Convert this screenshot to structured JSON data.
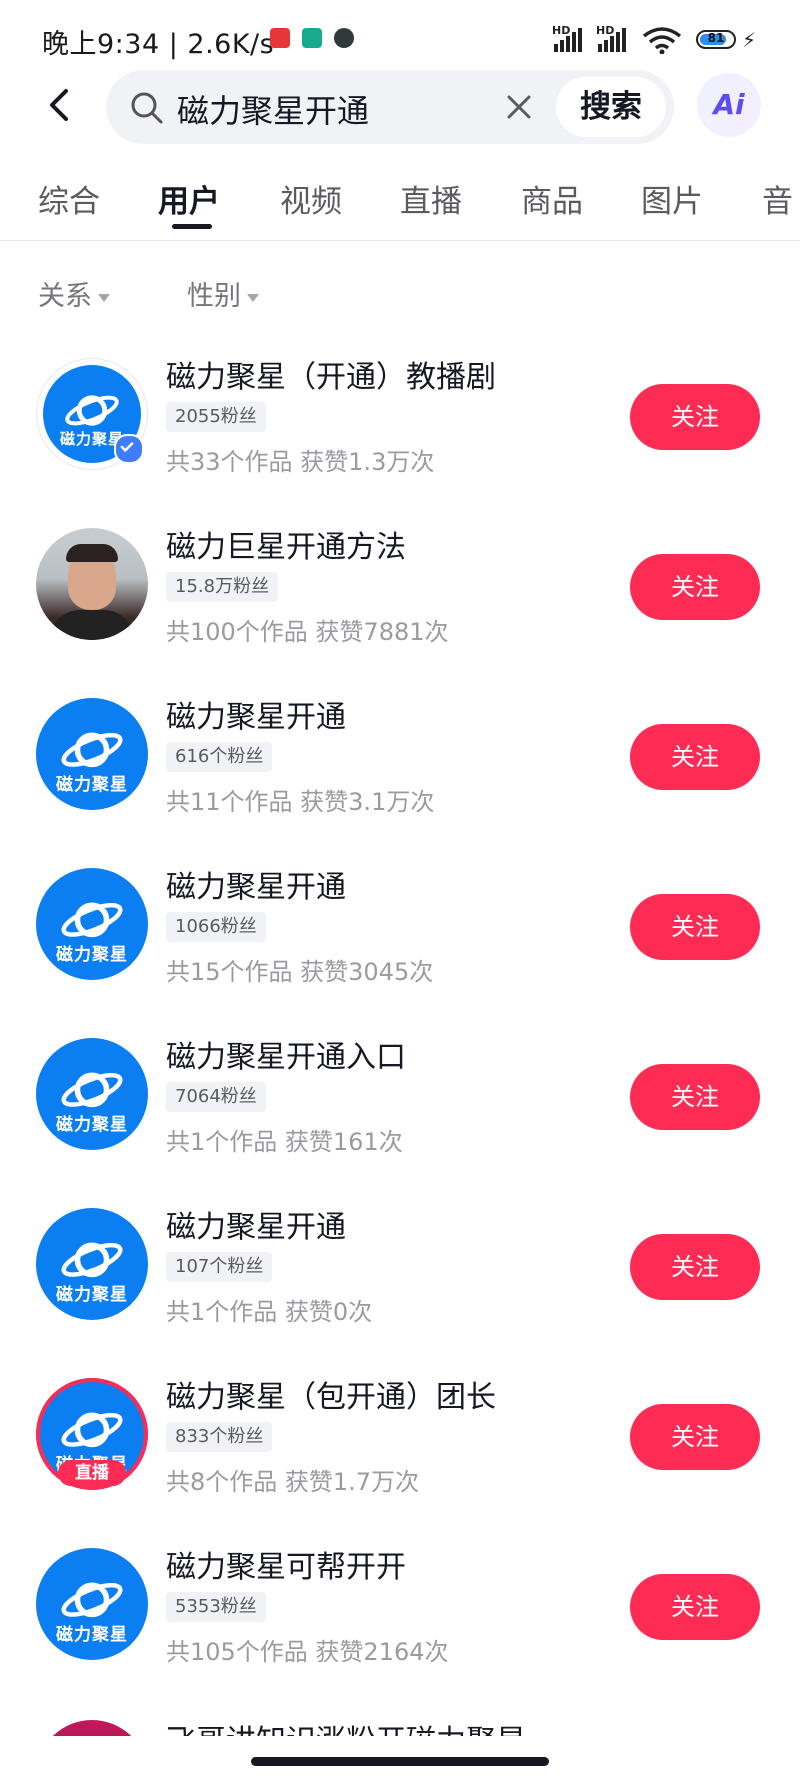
{
  "status_bar": {
    "time": "晚上9:34 | 2.6K/s",
    "signal1_label": "HD",
    "signal2_label": "HD",
    "battery": "81",
    "battery_level": 0.81
  },
  "search": {
    "query": "磁力聚星开通",
    "button_label": "搜索",
    "ai_label": "Ai"
  },
  "tabs": [
    {
      "label": "综合"
    },
    {
      "label": "用户"
    },
    {
      "label": "视频"
    },
    {
      "label": "直播"
    },
    {
      "label": "商品"
    },
    {
      "label": "图片"
    },
    {
      "label": "音"
    }
  ],
  "active_tab": "用户",
  "filters": [
    {
      "label": "关系"
    },
    {
      "label": "性别"
    }
  ],
  "results": [
    {
      "name": "磁力聚星（开通）教播剧",
      "fans": "2055粉丝",
      "meta": "共33个作品 获赞1.3万次",
      "follow": "关注",
      "avatar_text": "磁力聚星",
      "verified": true
    },
    {
      "name": "磁力巨星开通方法",
      "fans": "15.8万粉丝",
      "meta": "共100个作品 获赞7881次",
      "follow": "关注",
      "avatar_text": ""
    },
    {
      "name": "磁力聚星开通",
      "fans": "616个粉丝",
      "meta": "共11个作品 获赞3.1万次",
      "follow": "关注",
      "avatar_text": "磁力聚星"
    },
    {
      "name": "磁力聚星开通",
      "fans": "1066粉丝",
      "meta": "共15个作品 获赞3045次",
      "follow": "关注",
      "avatar_text": "磁力聚星"
    },
    {
      "name": "磁力聚星开通入口",
      "fans": "7064粉丝",
      "meta": "共1个作品 获赞161次",
      "follow": "关注",
      "avatar_text": "磁力聚星"
    },
    {
      "name": "磁力聚星开通",
      "fans": "107个粉丝",
      "meta": "共1个作品 获赞0次",
      "follow": "关注",
      "avatar_text": "磁力聚星"
    },
    {
      "name": "磁力聚星（包开通）团长",
      "fans": "833个粉丝",
      "meta": "共8个作品 获赞1.7万次",
      "follow": "关注",
      "avatar_text": "磁力聚星",
      "live_label": "直播"
    },
    {
      "name": "磁力聚星可帮开开",
      "fans": "5353粉丝",
      "meta": "共105个作品 获赞2164次",
      "follow": "关注",
      "avatar_text": "磁力聚星"
    },
    {
      "name": "飞哥讲知识涨粉开磁力聚星"
    }
  ],
  "colors": {
    "accent": "#fe2c55",
    "avatar_blue": "#0b7ef2",
    "verify_blue": "#3f7dff",
    "search_bg": "#f1f2f5"
  }
}
